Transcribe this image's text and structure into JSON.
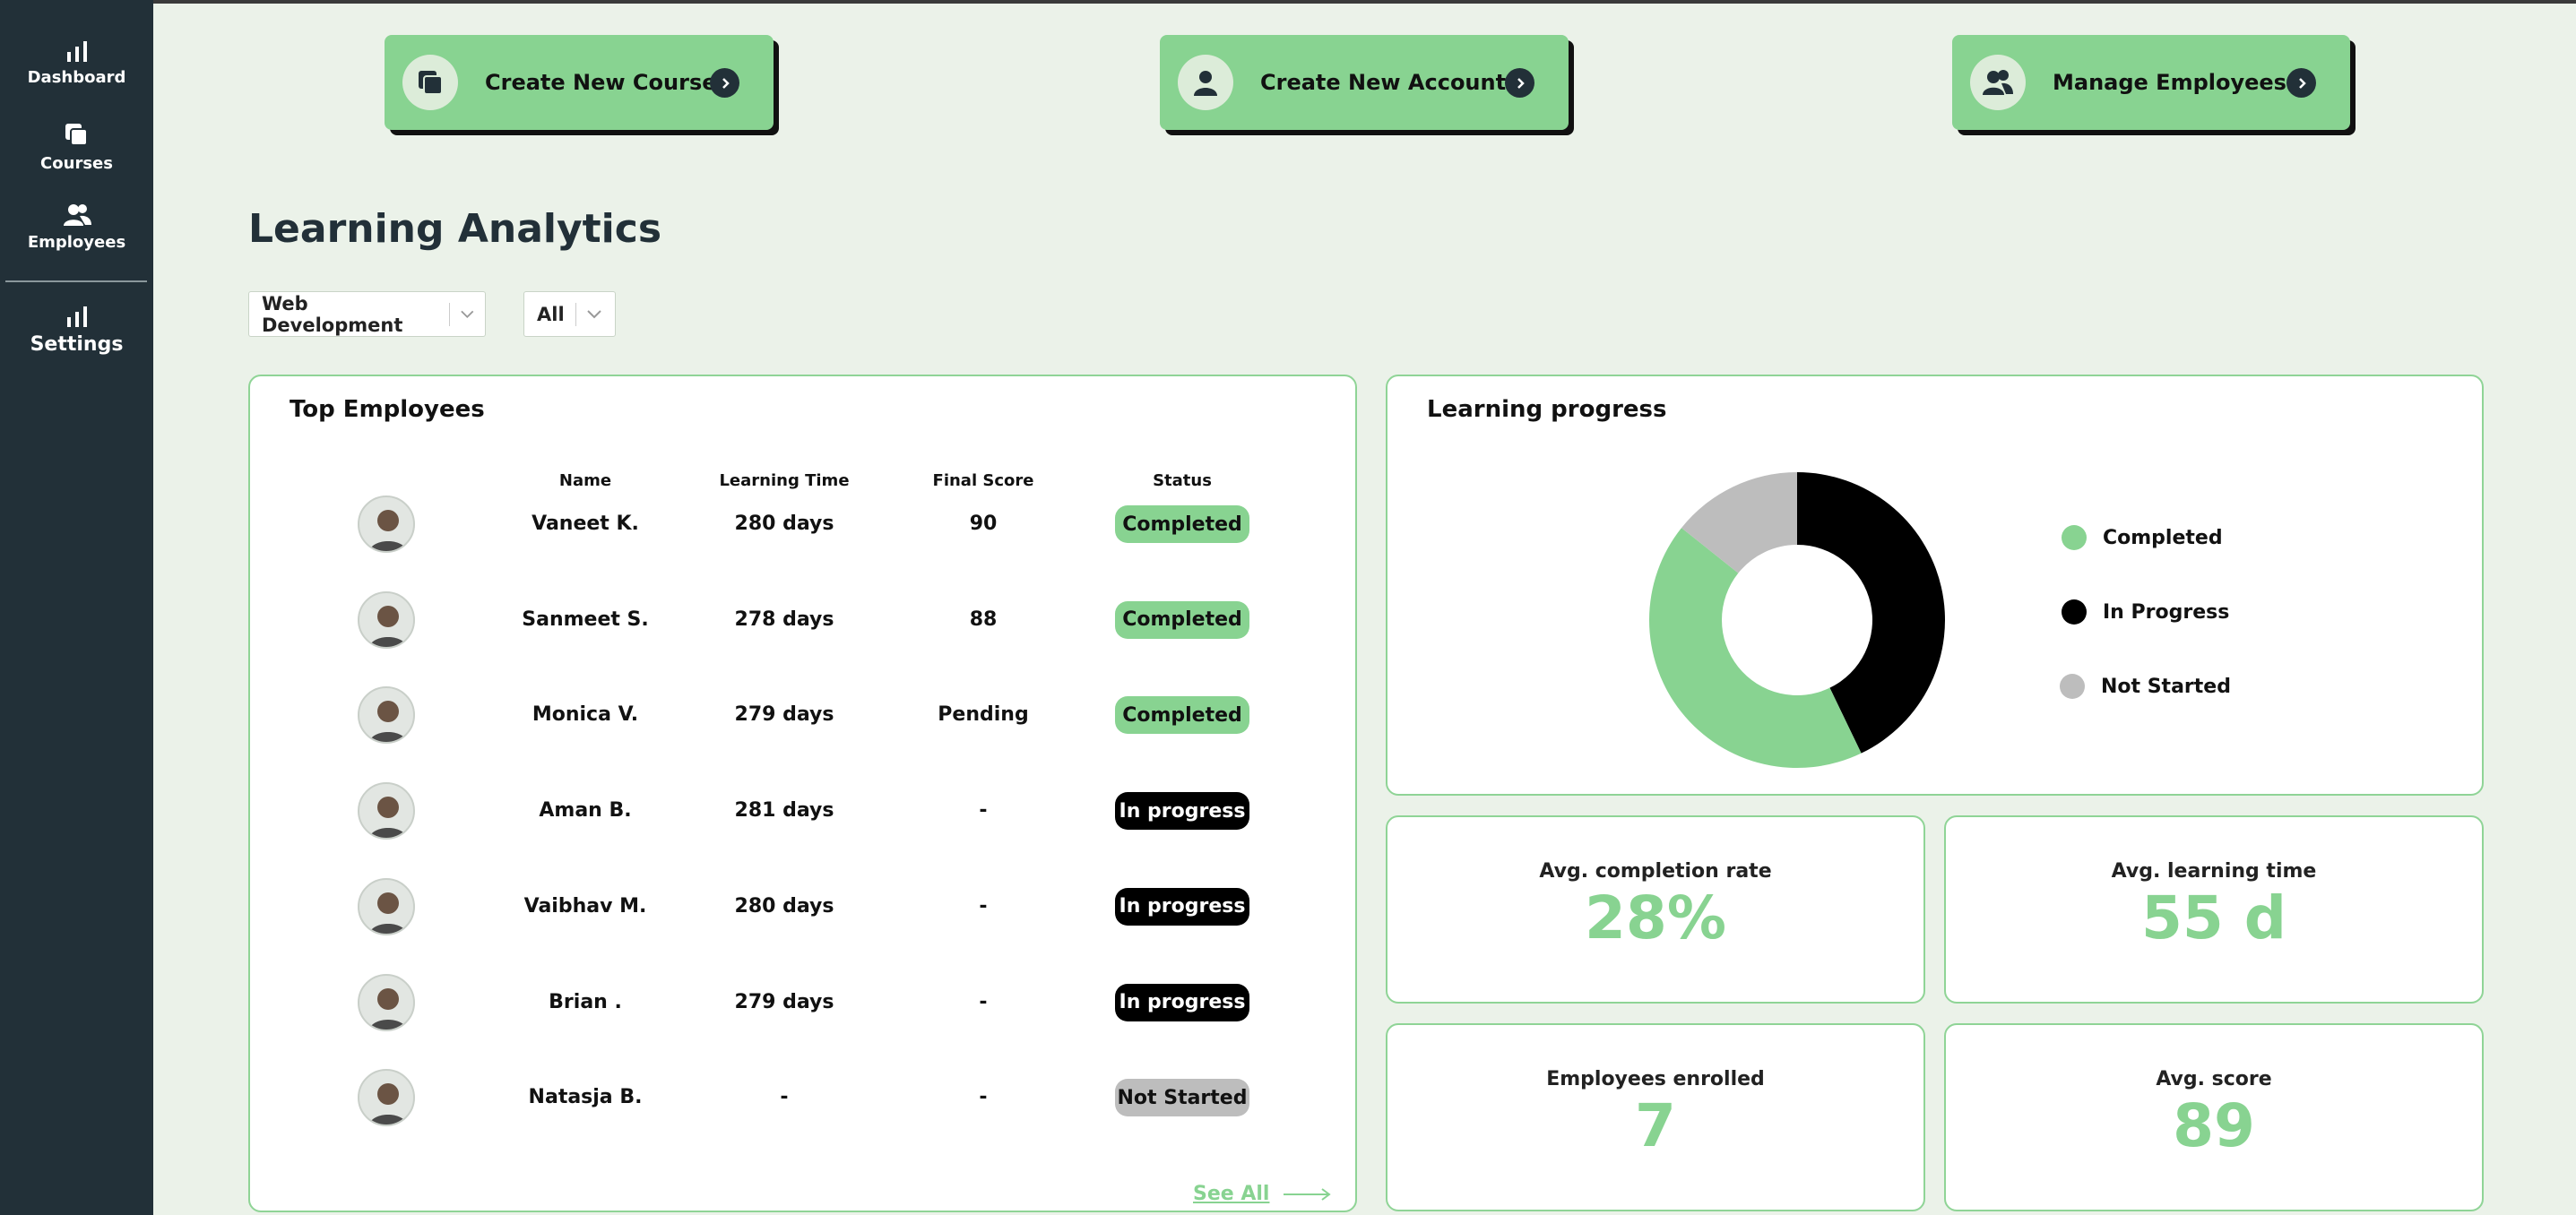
{
  "sidebar": {
    "items": [
      {
        "label": "Dashboard",
        "icon": "bar-chart-icon"
      },
      {
        "label": "Courses",
        "icon": "copy-icon"
      },
      {
        "label": "Employees",
        "icon": "users-icon"
      },
      {
        "label": "Settings",
        "icon": "bar-chart-icon"
      }
    ]
  },
  "actions": [
    {
      "label": "Create New Course",
      "icon": "copy-icon"
    },
    {
      "label": "Create New Account",
      "icon": "user-icon"
    },
    {
      "label": "Manage Employees",
      "icon": "users-icon"
    }
  ],
  "page": {
    "title": "Learning Analytics"
  },
  "filters": {
    "course": "Web Development",
    "scope": "All"
  },
  "top_employees": {
    "title": "Top Employees",
    "columns": [
      "Name",
      "Learning Time",
      "Final Score",
      "Status"
    ],
    "rows": [
      {
        "name": "Vaneet K.",
        "time": "280 days",
        "score": "90",
        "status": "Completed"
      },
      {
        "name": "Sanmeet S.",
        "time": "278 days",
        "score": "88",
        "status": "Completed"
      },
      {
        "name": "Monica V.",
        "time": "279 days",
        "score": "Pending",
        "status": "Completed"
      },
      {
        "name": "Aman B.",
        "time": "281 days",
        "score": "-",
        "status": "In progress"
      },
      {
        "name": "Vaibhav M.",
        "time": "280 days",
        "score": "-",
        "status": "In progress"
      },
      {
        "name": "Brian .",
        "time": "279 days",
        "score": "-",
        "status": "In progress"
      },
      {
        "name": "Natasja B.",
        "time": "-",
        "score": "-",
        "status": "Not Started"
      }
    ],
    "see_all": "See All"
  },
  "learning_progress": {
    "title": "Learning progress",
    "legend": [
      "Completed",
      "In Progress",
      "Not Started"
    ]
  },
  "chart_data": {
    "type": "pie",
    "categories": [
      "Completed",
      "In Progress",
      "Not Started"
    ],
    "values": [
      3,
      3,
      1
    ],
    "colors": [
      "#88d391",
      "#000000",
      "#bdbdbd"
    ]
  },
  "stats": {
    "completion": {
      "label": "Avg. completion rate",
      "value": "28%"
    },
    "learning_time": {
      "label": "Avg. learning time",
      "value": "55 d"
    },
    "enrolled": {
      "label": "Employees enrolled",
      "value": "7"
    },
    "score": {
      "label": "Avg. score",
      "value": "89"
    }
  },
  "colors": {
    "accent": "#88d391",
    "sidebar": "#223038",
    "background": "#ebf2e9"
  }
}
